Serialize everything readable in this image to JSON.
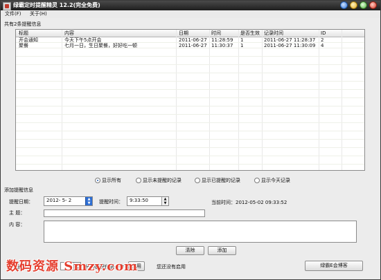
{
  "window": {
    "title": "绿霸定时提醒精灵 12.2(完全免费)",
    "controls": [
      "star-icon",
      "minimize-icon",
      "maximize-icon",
      "close-icon"
    ]
  },
  "menu": {
    "items": [
      "文件(F)",
      "关于(H)"
    ]
  },
  "list_panel": {
    "title": "共有2条提醒信息",
    "columns": [
      "标题",
      "内容",
      "日期",
      "时间",
      "是否生效",
      "记录时间",
      "ID"
    ],
    "rows": [
      [
        "开会通知",
        "今天下午5点开会",
        "2011-06-27",
        "11:28:59",
        "1",
        "2011-06-27 11:28:37",
        "2"
      ],
      [
        "聚餐",
        "七月一日，生日聚餐，好好吃一顿",
        "2011-06-27",
        "11:30:37",
        "1",
        "2011-06-27 11:30:09",
        "4"
      ]
    ]
  },
  "filter": {
    "options": [
      "显示所有",
      "显示未提醒的记录",
      "显示已提醒的记录",
      "显示今天记录"
    ],
    "selected": "显示所有"
  },
  "add_panel": {
    "title": "添加提醒信息",
    "date_label": "提醒日期：",
    "date_value": "2012- 5- 2",
    "time_label": "提醒时间：",
    "time_value": "9:33:50",
    "current_time": "当前时间：2012-05-02 09:33:52",
    "subject_label": "主    题：",
    "subject_value": "",
    "content_label": "内    容：",
    "content_value": "",
    "clear_button": "清除",
    "add_button": "添加"
  },
  "bottom": {
    "prefix": "提醒时",
    "suffix": "分钟提醒作息一会",
    "apply_button": "应用",
    "status": "您还没有启用",
    "blog_button": "绿霸E会博客"
  },
  "watermark": "数码资源 Smzy.com",
  "colors": {
    "titlebar": "#1e1e1e",
    "selected_date_spin": "#2f6fd3",
    "watermark": "#e53e2e"
  }
}
